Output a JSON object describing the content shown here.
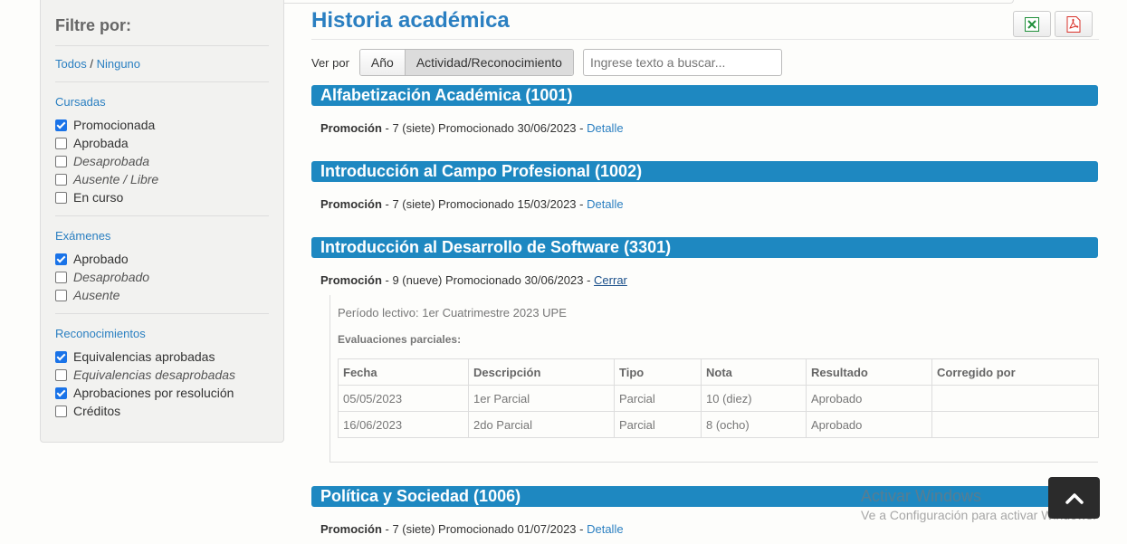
{
  "sidebar": {
    "title": "Filtre por:",
    "todos": "Todos",
    "separator": "/",
    "ninguno": "Ninguno",
    "groups": [
      {
        "title": "Cursadas",
        "items": [
          {
            "label": "Promocionada",
            "checked": true
          },
          {
            "label": "Aprobada",
            "checked": false
          },
          {
            "label": "Desaprobada",
            "checked": false
          },
          {
            "label": "Ausente / Libre",
            "checked": false
          },
          {
            "label": "En curso",
            "checked": false
          }
        ]
      },
      {
        "title": "Exámenes",
        "items": [
          {
            "label": "Aprobado",
            "checked": true
          },
          {
            "label": "Desaprobado",
            "checked": false
          },
          {
            "label": "Ausente",
            "checked": false
          }
        ]
      },
      {
        "title": "Reconocimientos",
        "items": [
          {
            "label": "Equivalencias aprobadas",
            "checked": true
          },
          {
            "label": "Equivalencias desaprobadas",
            "checked": false
          },
          {
            "label": "Aprobaciones por resolución",
            "checked": true
          },
          {
            "label": "Créditos",
            "checked": false
          }
        ]
      }
    ]
  },
  "main": {
    "title": "Historia académica",
    "ver_por": "Ver por",
    "seg_anio": "Año",
    "seg_actividad": "Actividad/Reconocimiento",
    "search_placeholder": "Ingrese texto a buscar...",
    "courses": [
      {
        "name": "Alfabetización Académica (1001)",
        "tipo": "Promoción",
        "text": " - 7 (siete) Promocionado 30/06/2023 - ",
        "link": "Detalle"
      },
      {
        "name": "Introducción al Campo Profesional (1002)",
        "tipo": "Promoción",
        "text": " - 7 (siete) Promocionado 15/03/2023 - ",
        "link": "Detalle"
      },
      {
        "name": "Introducción al Desarrollo de Software (3301)",
        "tipo": "Promoción",
        "text": " - 9 (nueve) Promocionado 30/06/2023 - ",
        "link": "Cerrar"
      },
      {
        "name": "Política y Sociedad (1006)",
        "tipo": "Promoción",
        "text": " - 7 (siete) Promocionado 01/07/2023 - ",
        "link": "Detalle"
      }
    ],
    "detail": {
      "periodo": "Período lectivo: 1er Cuatrimestre 2023 UPE",
      "evaluaciones": "Evaluaciones parciales:",
      "headers": [
        "Fecha",
        "Descripción",
        "Tipo",
        "Nota",
        "Resultado",
        "Corregido por"
      ],
      "rows": [
        [
          "05/05/2023",
          "1er Parcial",
          "Parcial",
          "10 (diez)",
          "Aprobado",
          ""
        ],
        [
          "16/06/2023",
          "2do Parcial",
          "Parcial",
          "8 (ocho)",
          "Aprobado",
          ""
        ]
      ]
    }
  },
  "watermark": {
    "line1": "Activar Windows",
    "line2": "Ve a Configuración para activar Windows."
  },
  "icons": {
    "excel": "excel-icon",
    "pdf": "pdf-icon",
    "scroll_top": "chevron-up-icon"
  },
  "colors": {
    "accent": "#2a7fc1",
    "bar": "#1e88c1"
  }
}
